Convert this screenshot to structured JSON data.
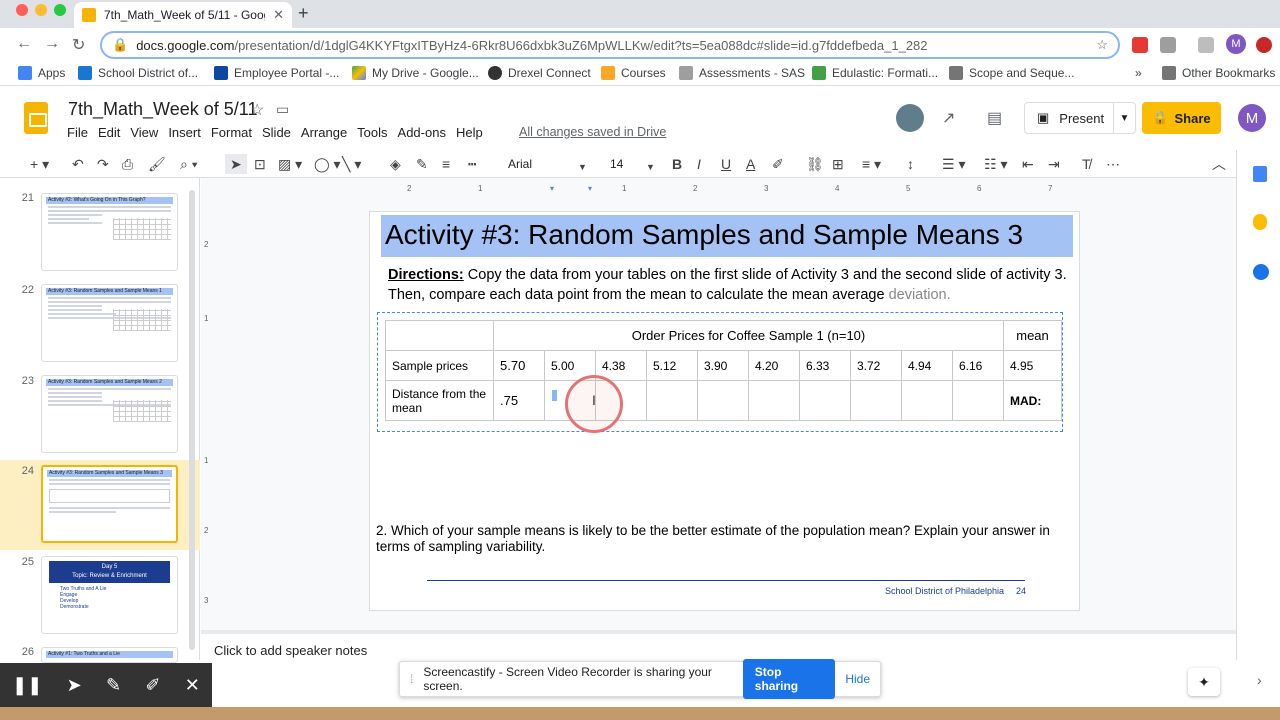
{
  "browser": {
    "tab_title": "7th_Math_Week of 5/11 - Goog",
    "url_host": "docs.google.com",
    "url_path": "/presentation/d/1dglG4KKYFtgxITByHz4-6Rkr8U66dxbk3uZ6MpWLLKw/edit?ts=5ea088dc#slide=id.g7fddefbeda_1_282",
    "avatar_letter": "M",
    "bookmarks": [
      "Apps",
      "School District of...",
      "Employee Portal -...",
      "My Drive - Google...",
      "Drexel Connect",
      "Courses",
      "Assessments - SAS",
      "Edulastic: Formati...",
      "Scope and Seque..."
    ],
    "other_bookmarks": "Other Bookmarks"
  },
  "app": {
    "doc_title": "7th_Math_Week of 5/11",
    "menu": [
      "File",
      "Edit",
      "View",
      "Insert",
      "Format",
      "Slide",
      "Arrange",
      "Tools",
      "Add-ons",
      "Help"
    ],
    "saved_status": "All changes saved in Drive",
    "present_label": "Present",
    "share_label": "Share",
    "user_letter": "M",
    "font_name": "Arial",
    "font_size": "14"
  },
  "filmstrip": [
    {
      "num": "21",
      "title": "Activity #2: What's Going On in This Graph?"
    },
    {
      "num": "22",
      "title": "Activity #3: Random Samples and Sample Means 1"
    },
    {
      "num": "23",
      "title": "Activity #3: Random Samples and Sample Means 2"
    },
    {
      "num": "24",
      "title": "Activity #3: Random Samples and Sample Means 3"
    },
    {
      "num": "25",
      "title": "Day 5",
      "subtitle": "Topic: Review & Enrichment",
      "items": [
        "Two Truths and A Lie",
        "Engage",
        "Develop",
        "Demonstrate"
      ]
    },
    {
      "num": "26",
      "title": "Activity #1: Two Truths and a Lie"
    }
  ],
  "slide": {
    "title": "Activity #3: Random Samples and Sample Means 3",
    "directions_label": "Directions:",
    "directions_text": " Copy the data from your tables on the first slide of Activity 3 and the second slide of activity 3. Then, compare each data point from the mean to calculate the mean average ",
    "directions_tail": "deviation.",
    "table": {
      "header": "Order Prices for Coffee Sample 1 (n=10)",
      "mean_header": "mean",
      "row1_label": "Sample prices",
      "row1_values": [
        "5.70",
        "5.00",
        "4.38",
        "5.12",
        "3.90",
        "4.20",
        "6.33",
        "3.72",
        "4.94",
        "6.16"
      ],
      "row1_mean": "4.95",
      "row2_label": "Distance from the mean",
      "row2_values": [
        ".75",
        "",
        "",
        "",
        "",
        "",
        "",
        "",
        "",
        ""
      ],
      "row2_mean": "MAD:"
    },
    "question2": "2. Which of your sample means is likely to be the better estimate of the population mean? Explain your answer in terms of sampling variability.",
    "footer": "School District of Philadelphia",
    "page": "24"
  },
  "speaker_notes": "Click to add speaker notes",
  "screencastify": {
    "message": "Screencastify - Screen Video Recorder is sharing your screen.",
    "stop": "Stop sharing",
    "hide": "Hide"
  }
}
